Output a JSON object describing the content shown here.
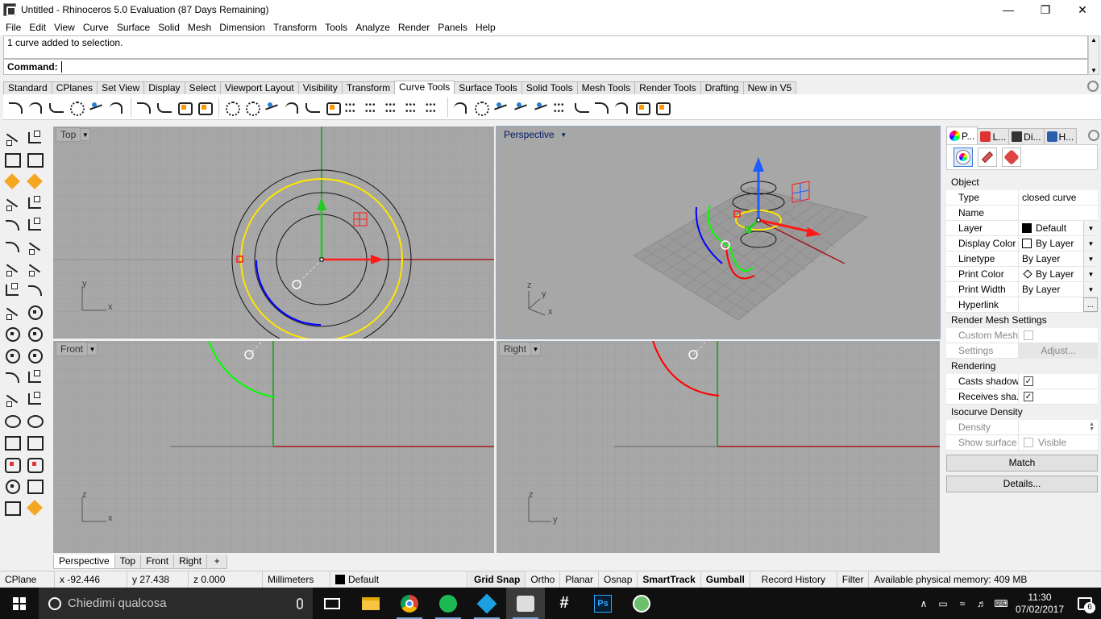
{
  "window": {
    "title": "Untitled - Rhinoceros 5.0 Evaluation (87 Days Remaining)",
    "minimize": "—",
    "maximize": "❐",
    "close": "✕"
  },
  "menu": [
    "File",
    "Edit",
    "View",
    "Curve",
    "Surface",
    "Solid",
    "Mesh",
    "Dimension",
    "Transform",
    "Tools",
    "Analyze",
    "Render",
    "Panels",
    "Help"
  ],
  "command": {
    "history": "1 curve added to selection.",
    "label": "Command:",
    "value": ""
  },
  "toolbar_tabs": {
    "items": [
      "Standard",
      "CPlanes",
      "Set View",
      "Display",
      "Select",
      "Viewport Layout",
      "Visibility",
      "Transform",
      "Curve Tools",
      "Surface Tools",
      "Solid Tools",
      "Mesh Tools",
      "Render Tools",
      "Drafting",
      "New in V5"
    ],
    "active": "Curve Tools"
  },
  "viewports": {
    "top": {
      "label": "Top",
      "axis_h": "x",
      "axis_v": "y"
    },
    "perspective": {
      "label": "Perspective",
      "axis_h": "x",
      "axis_v": "z",
      "axis_d": "y"
    },
    "front": {
      "label": "Front",
      "axis_h": "x",
      "axis_v": "z"
    },
    "right": {
      "label": "Right",
      "axis_h": "y",
      "axis_v": "z"
    }
  },
  "viewport_tabs": [
    "Perspective",
    "Top",
    "Front",
    "Right"
  ],
  "viewport_tab_add": "+",
  "panel": {
    "tabs": [
      {
        "label": "P...",
        "icon": "properties-icon"
      },
      {
        "label": "L...",
        "icon": "layers-icon"
      },
      {
        "label": "Di...",
        "icon": "display-icon"
      },
      {
        "label": "H...",
        "icon": "help-icon"
      }
    ],
    "sections": {
      "object": "Object",
      "render_mesh": "Render Mesh Settings",
      "rendering": "Rendering",
      "isocurve": "Isocurve Density"
    },
    "object": {
      "type_k": "Type",
      "type_v": "closed curve",
      "name_k": "Name",
      "name_v": "",
      "layer_k": "Layer",
      "layer_v": "Default",
      "display_color_k": "Display Color",
      "display_color_v": "By Layer",
      "linetype_k": "Linetype",
      "linetype_v": "By Layer",
      "print_color_k": "Print Color",
      "print_color_v": "By Layer",
      "print_width_k": "Print Width",
      "print_width_v": "By Layer",
      "hyperlink_k": "Hyperlink",
      "hyperlink_btn": "..."
    },
    "render_mesh": {
      "custom_mesh_k": "Custom Mesh",
      "settings_k": "Settings",
      "adjust_btn": "Adjust..."
    },
    "rendering": {
      "casts_k": "Casts shadows",
      "casts_checked": true,
      "receives_k": "Receives sha...",
      "receives_checked": true
    },
    "isocurve": {
      "density_k": "Density",
      "show_surface_k": "Show surface ...",
      "visible_label": "Visible"
    },
    "match_btn": "Match",
    "details_btn": "Details..."
  },
  "status": {
    "cplane": "CPlane",
    "x": "x -92.446",
    "y": "y 27.438",
    "z": "z 0.000",
    "units": "Millimeters",
    "layer": "Default",
    "grid_snap": "Grid Snap",
    "ortho": "Ortho",
    "planar": "Planar",
    "osnap": "Osnap",
    "smarttrack": "SmartTrack",
    "gumball": "Gumball",
    "record_history": "Record History",
    "filter": "Filter",
    "memory": "Available physical memory: 409 MB"
  },
  "taskbar": {
    "search_placeholder": "Chiedimi qualcosa",
    "time": "11:30",
    "date": "07/02/2017",
    "notifications": "6",
    "ps_label": "Ps",
    "slack_label": "#",
    "tray_up": "∧"
  },
  "colors": {
    "viewport_bg": "#a7a7a7",
    "grid_minor": "#9c9c9c",
    "grid_major": "#8a8a8a",
    "axis_x": "#a51818",
    "axis_y": "#15a015",
    "gumball_red": "#ff1a1a",
    "gumball_green": "#22cc22",
    "gumball_blue": "#1e5cff",
    "curve_yellow": "#ffe600",
    "curve_blue": "#0000ff",
    "curve_green": "#00ff00",
    "curve_red": "#ff0000"
  }
}
